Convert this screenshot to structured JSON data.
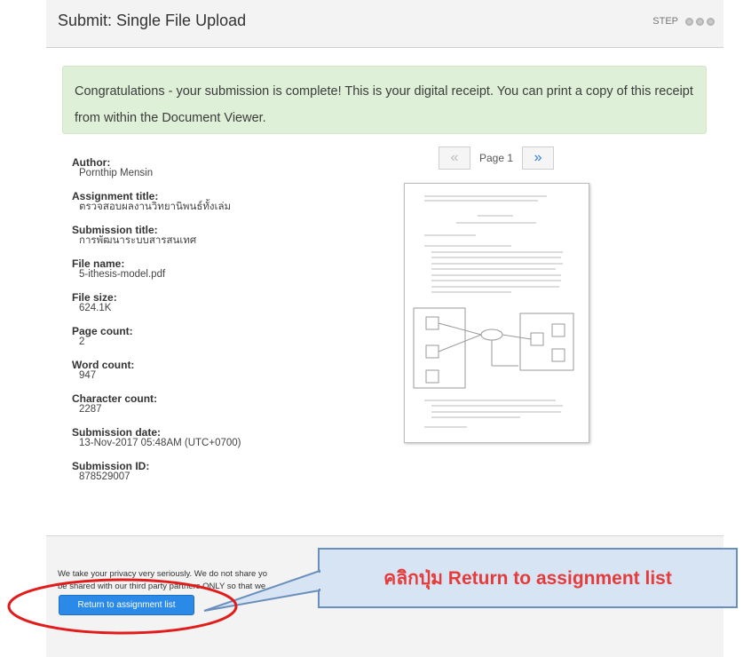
{
  "header": {
    "title": "Submit: Single File Upload",
    "step_label": "STEP"
  },
  "alert": {
    "message": "Congratulations - your submission is complete! This is your digital receipt. You can print a copy of this receipt from within the Document Viewer."
  },
  "receipt": {
    "fields": [
      {
        "label": "Author:",
        "value": "Pornthip Mensin"
      },
      {
        "label": "Assignment title:",
        "value": "ตรวจสอบผลงานวิทยานิพนธ์ทั้งเล่ม"
      },
      {
        "label": "Submission title:",
        "value": "การพัฒนาระบบสารสนเทศ"
      },
      {
        "label": "File name:",
        "value": "5-ithesis-model.pdf"
      },
      {
        "label": "File size:",
        "value": "624.1K"
      },
      {
        "label": "Page count:",
        "value": "2"
      },
      {
        "label": "Word count:",
        "value": "947"
      },
      {
        "label": "Character count:",
        "value": "2287"
      },
      {
        "label": "Submission date:",
        "value": "13-Nov-2017 05:48AM (UTC+0700)"
      },
      {
        "label": "Submission ID:",
        "value": "878529007"
      }
    ]
  },
  "viewer": {
    "prev_label": "«",
    "page_label": "Page 1",
    "next_label": "»"
  },
  "footer": {
    "privacy_line1": "We take your privacy very seriously. We do not share yo",
    "privacy_line2": "be shared with our third party partners ONLY so that we",
    "return_button": "Return to assignment list"
  },
  "callout": {
    "text": "คลิกปุ่ม Return to assignment list"
  },
  "colors": {
    "alert_bg": "#dff0d8",
    "button": "#2b8ae8",
    "highlight_ellipse": "#e21b1b",
    "callout_text": "#e53b3b"
  }
}
